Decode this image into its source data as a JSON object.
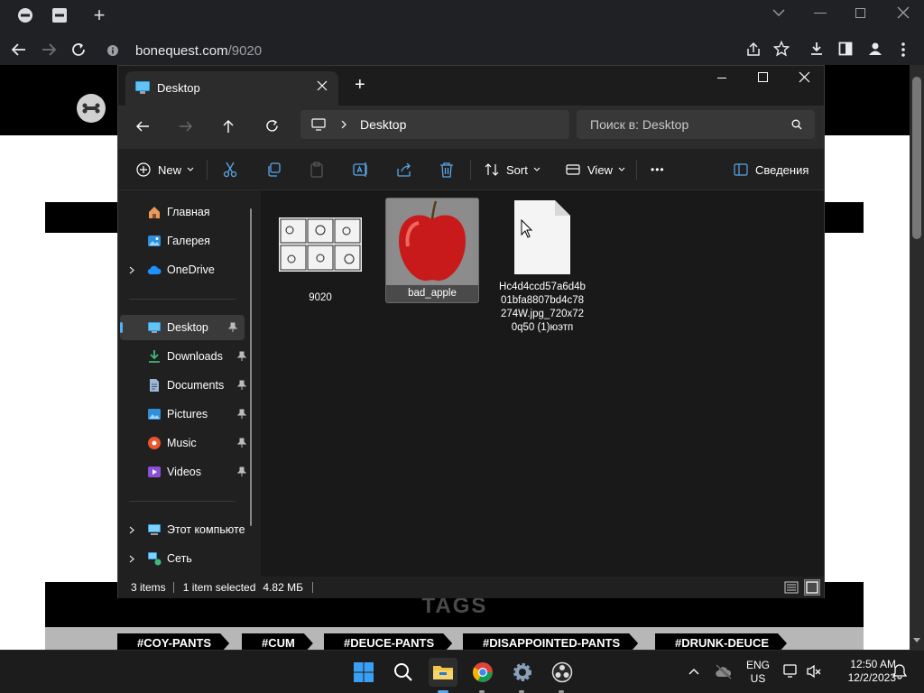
{
  "browser": {
    "tab_close_icon": "close-icon",
    "new_tab": "+",
    "url_domain": "bonequest.com",
    "url_path": "/9020"
  },
  "website": {
    "tags_heading": "TAGS",
    "tags": [
      "#COY-PANTS",
      "#CUM",
      "#DEUCE-PANTS",
      "#DISAPPOINTED-PANTS",
      "#DRUNK-DEUCE"
    ]
  },
  "explorer": {
    "tab_title": "Desktop",
    "address": "Desktop",
    "search_placeholder": "Поиск в: Desktop",
    "toolbar": {
      "new_label": "New",
      "sort_label": "Sort",
      "view_label": "View",
      "more_label": "•••",
      "details_label": "Сведения"
    },
    "nav": [
      {
        "label": "Главная",
        "icon": "home-icon",
        "pinned": false,
        "expand": false
      },
      {
        "label": "Галерея",
        "icon": "gallery-icon",
        "pinned": false,
        "expand": false
      },
      {
        "label": "OneDrive",
        "icon": "cloud-icon",
        "pinned": false,
        "expand": true
      },
      {
        "label": "Desktop",
        "icon": "desktop-icon",
        "pinned": true,
        "expand": false
      },
      {
        "label": "Downloads",
        "icon": "download-icon",
        "pinned": true,
        "expand": false
      },
      {
        "label": "Documents",
        "icon": "document-icon",
        "pinned": true,
        "expand": false
      },
      {
        "label": "Pictures",
        "icon": "pictures-icon",
        "pinned": true,
        "expand": false
      },
      {
        "label": "Music",
        "icon": "music-icon",
        "pinned": true,
        "expand": false
      },
      {
        "label": "Videos",
        "icon": "videos-icon",
        "pinned": true,
        "expand": false
      },
      {
        "label": "Этот компьюте",
        "icon": "computer-icon",
        "pinned": false,
        "expand": true
      },
      {
        "label": "Сеть",
        "icon": "network-icon",
        "pinned": false,
        "expand": true
      }
    ],
    "files": [
      {
        "name": "9020",
        "type": "comic-thumbnail"
      },
      {
        "name": "bad_apple",
        "type": "apple-image",
        "selected": true
      },
      {
        "name": "Hc4d4ccd57a6d4b01bfa8807bd4c78274W.jpg_720x720q50 (1)юэтп",
        "type": "blank-file"
      }
    ],
    "status": {
      "items": "3 items",
      "selected": "1 item selected",
      "size": "4.82 МБ"
    }
  },
  "taskbar": {
    "lang_line1": "ENG",
    "lang_line2": "US",
    "time": "12:50 AM",
    "date": "12/2/2023"
  }
}
